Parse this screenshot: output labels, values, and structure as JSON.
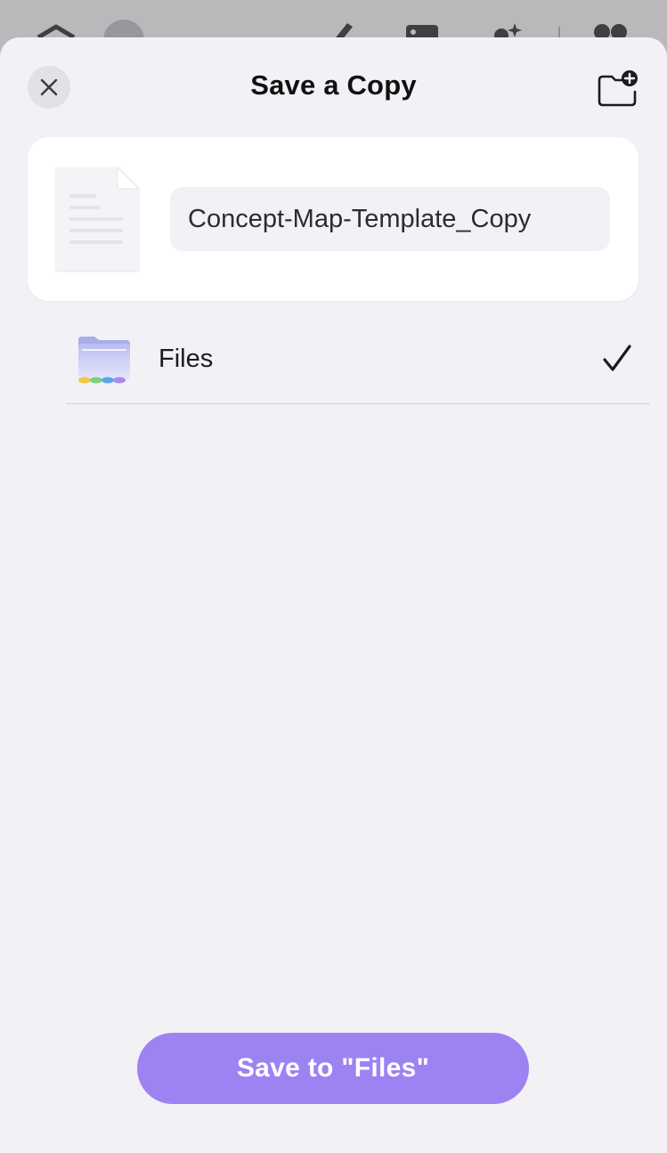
{
  "dialog": {
    "title": "Save a Copy",
    "close_icon": "close-icon",
    "new_folder_icon": "folder-plus-icon"
  },
  "file": {
    "name_value": "Concept-Map-Template_Copy",
    "thumbnail_icon": "document-icon"
  },
  "locations": [
    {
      "label": "Files",
      "icon": "files-folder-icon",
      "selected": true,
      "selected_icon": "checkmark-icon"
    }
  ],
  "actions": {
    "save_label": "Save to \"Files\""
  },
  "colors": {
    "accent": "#9d82f2",
    "sheet_background": "#f2f1f6",
    "card_background": "#ffffff",
    "title_text": "#111111"
  }
}
